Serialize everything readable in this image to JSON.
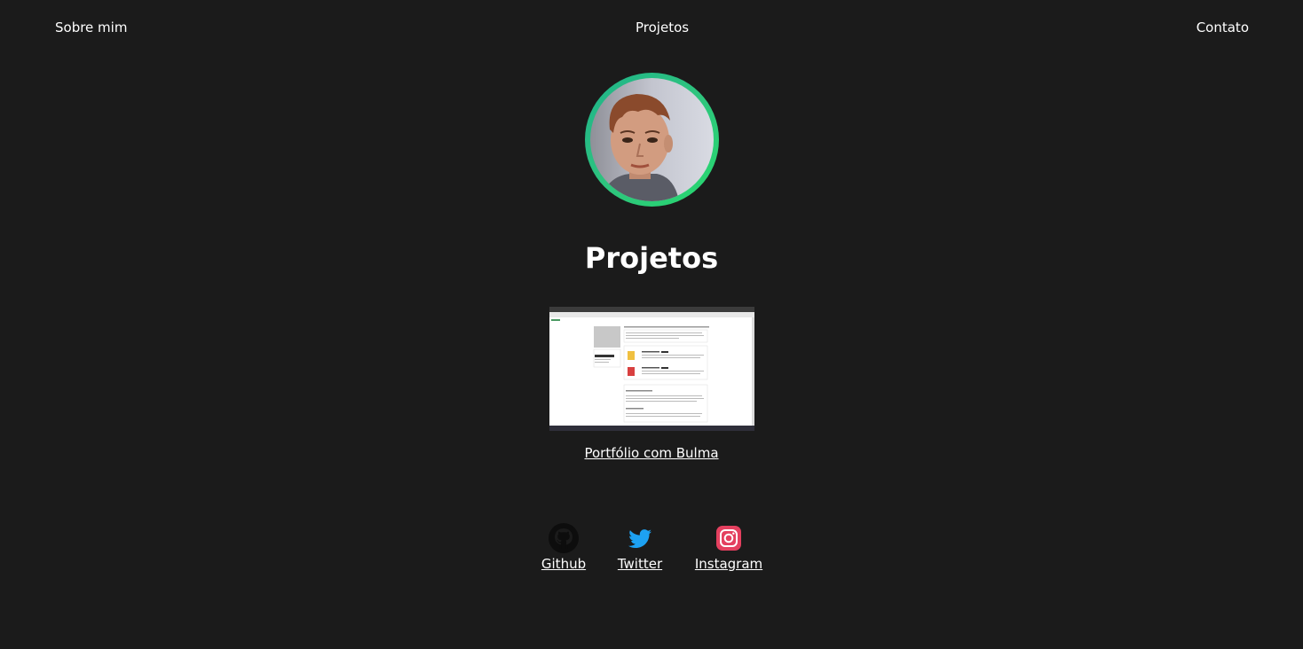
{
  "nav": {
    "items": [
      {
        "label": "Sobre mim"
      },
      {
        "label": "Projetos"
      },
      {
        "label": "Contato"
      }
    ]
  },
  "profile": {
    "avatar_ring_color": "#27c77a"
  },
  "section": {
    "title": "Projetos"
  },
  "project": {
    "link_label": "Portfólio com Bulma"
  },
  "social": [
    {
      "label": "Github",
      "icon": "github-icon"
    },
    {
      "label": "Twitter",
      "icon": "twitter-icon",
      "color": "#1da1f2"
    },
    {
      "label": "Instagram",
      "icon": "instagram-icon",
      "color": "#e4405f"
    }
  ],
  "colors": {
    "background": "#1b1b1b",
    "text": "#ffffff"
  }
}
